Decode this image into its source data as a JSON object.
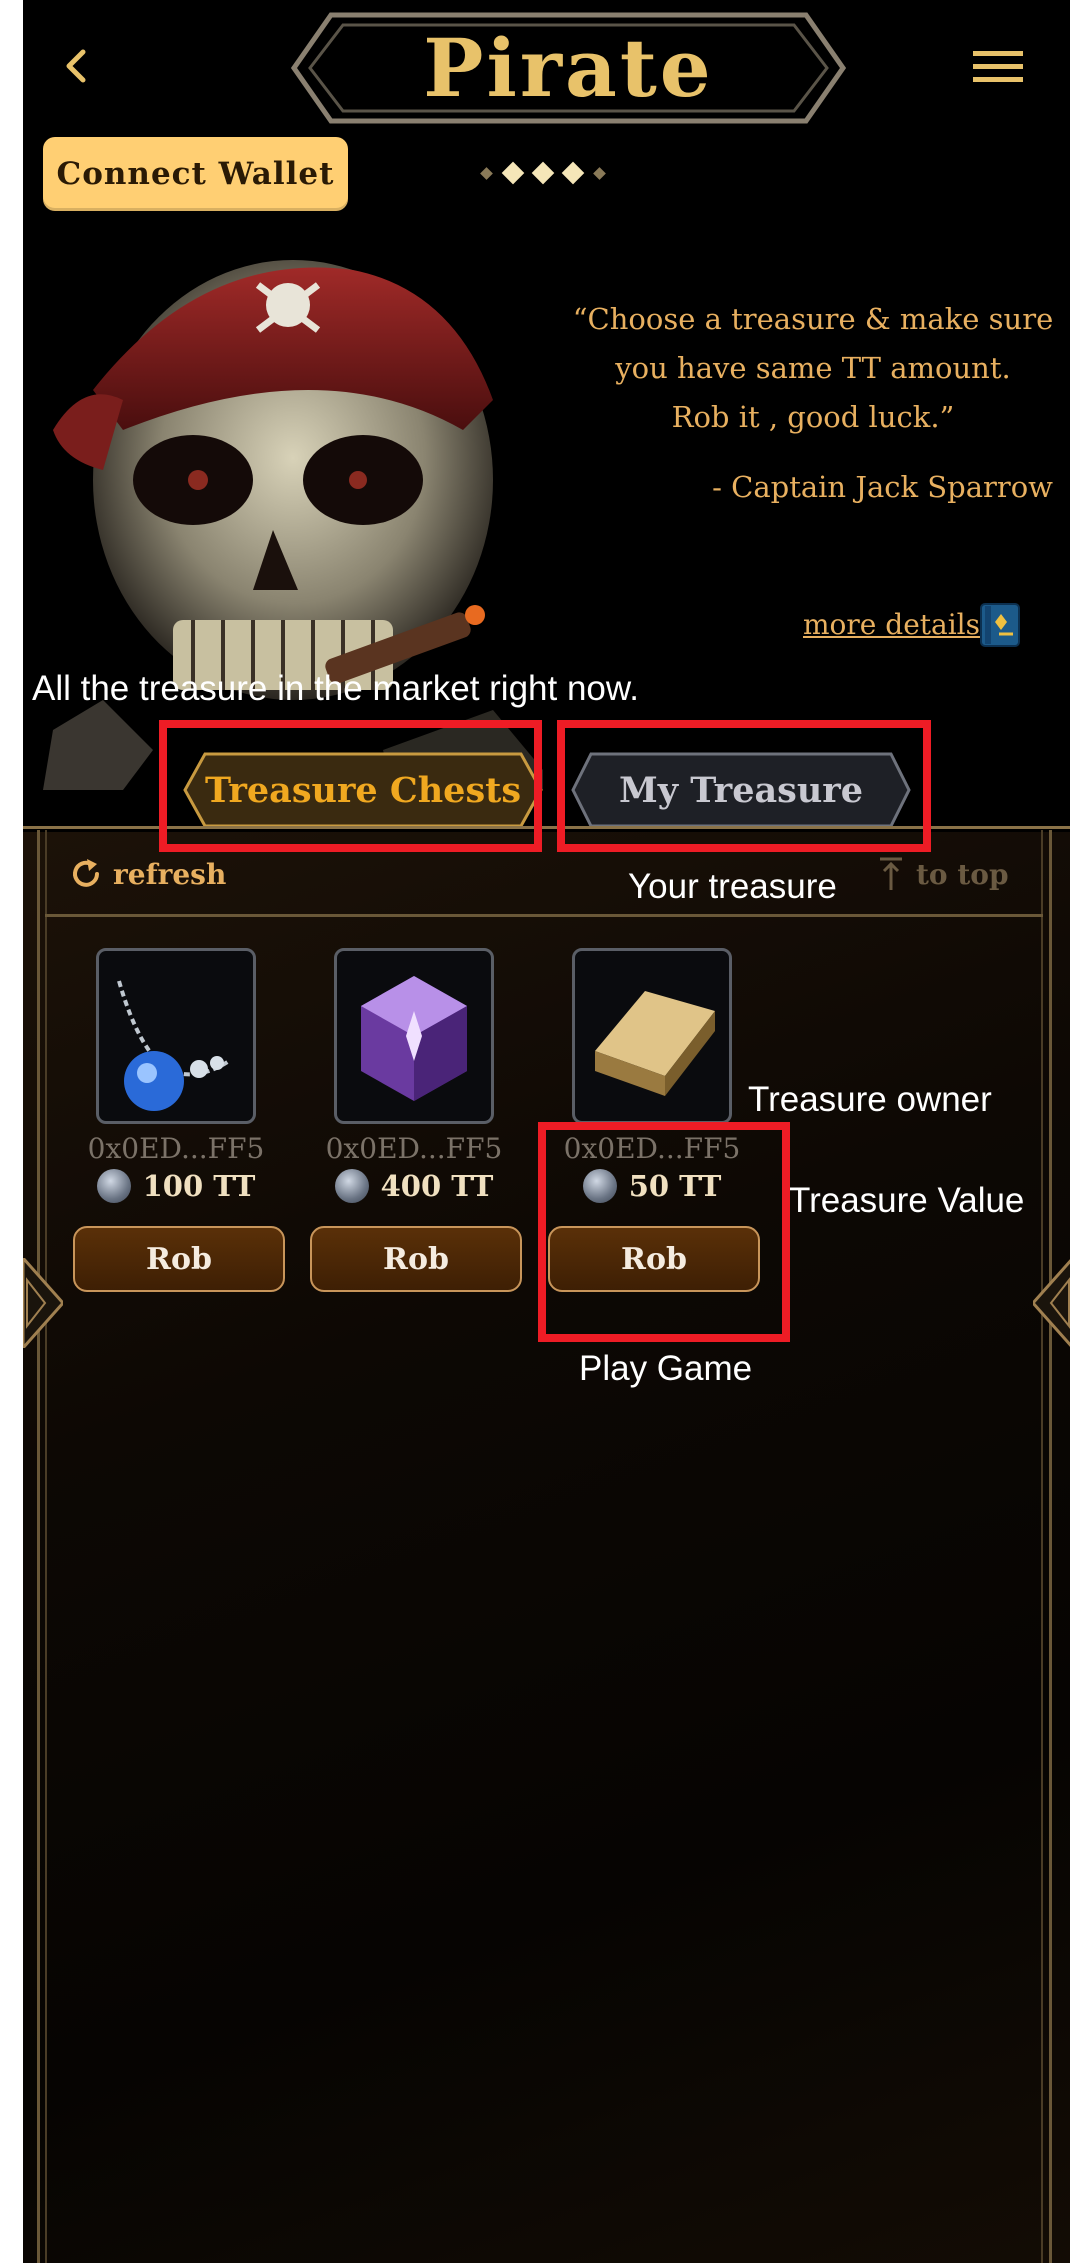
{
  "header": {
    "title": "Pirate",
    "back_icon": "chevron-left-icon",
    "menu_icon": "hamburger-menu-icon"
  },
  "wallet": {
    "connect_label": "Connect Wallet"
  },
  "hero": {
    "quote_lines": [
      "“Choose a treasure & make sure",
      "you have same TT amount.",
      "Rob it , good luck.”"
    ],
    "author": "- Captain Jack Sparrow",
    "more_details": "more details"
  },
  "tabs": [
    {
      "label": "Treasure Chests",
      "active": true
    },
    {
      "label": "My Treasure",
      "active": false
    }
  ],
  "toolbar": {
    "refresh": "refresh",
    "to_top": "to top"
  },
  "treasures": [
    {
      "owner": "0x0ED...FF5",
      "value": "100 TT",
      "action": "Rob",
      "icon": "blue-gem-necklace-icon"
    },
    {
      "owner": "0x0ED...FF5",
      "value": "400 TT",
      "action": "Rob",
      "icon": "purple-crystal-cube-icon"
    },
    {
      "owner": "0x0ED...FF5",
      "value": "50 TT",
      "action": "Rob",
      "icon": "gold-bar-icon"
    }
  ],
  "annotations": {
    "market": "All the treasure in the market right now.",
    "your_treasure": "Your treasure",
    "owner": "Treasure owner",
    "value": "Treasure Value",
    "play": "Play Game"
  },
  "colors": {
    "accent_gold": "#e8c26a",
    "wallet_button": "#ffcf73",
    "active_tab_text": "#f0a820",
    "annotation_box": "#ee1c25"
  }
}
